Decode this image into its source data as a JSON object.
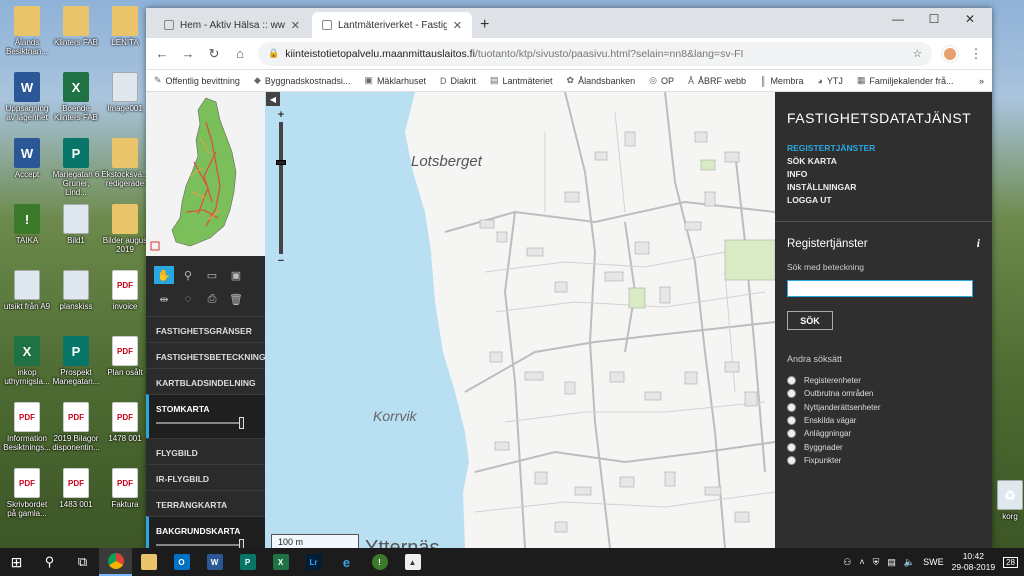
{
  "desktop": {
    "icons": [
      {
        "label": "Ålands Besiktnan...",
        "type": "folder"
      },
      {
        "label": "Klinters FAB",
        "type": "folder"
      },
      {
        "label": "LENITA",
        "type": "folder"
      },
      {
        "label": "Uppsägning av lägenhet",
        "type": "word"
      },
      {
        "label": "Boende Klinters FAB",
        "type": "excel"
      },
      {
        "label": "Image001",
        "type": "img"
      },
      {
        "label": "Accept",
        "type": "word"
      },
      {
        "label": "Mariegatan 6 Gruner, Lind...",
        "type": "pub"
      },
      {
        "label": "Ekstocksvä... redigerade",
        "type": "folder"
      },
      {
        "label": "TAIKA",
        "type": "app"
      },
      {
        "label": "Bild1",
        "type": "img"
      },
      {
        "label": "Bilder augus 2019",
        "type": "folder"
      },
      {
        "label": "utsikt från A9",
        "type": "img"
      },
      {
        "label": "planskiss",
        "type": "img"
      },
      {
        "label": "invoice",
        "type": "pdf"
      },
      {
        "label": "inkop uthyrnigsla...",
        "type": "excel"
      },
      {
        "label": "Prospekt Manegatan...",
        "type": "pub"
      },
      {
        "label": "Plan osålt",
        "type": "pdf"
      },
      {
        "label": "Information Besiktnings...",
        "type": "pdf"
      },
      {
        "label": "2019 Bilagor disponentin...",
        "type": "pdf"
      },
      {
        "label": "1478 001",
        "type": "pdf"
      },
      {
        "label": "Skrivbordet på gamla...",
        "type": "pdf"
      },
      {
        "label": "1483 001",
        "type": "pdf"
      },
      {
        "label": "Faktura",
        "type": "pdf"
      }
    ],
    "glyph_pdf": "PDF",
    "glyph_word": "W",
    "glyph_excel": "X",
    "glyph_pub": "P",
    "glyph_app": "!",
    "right_edge_label": "korg"
  },
  "browser": {
    "tabs": [
      {
        "label": "Hem - Aktiv Hälsa :: www.aland.",
        "active": false
      },
      {
        "label": "Lantmäteriverket - Fastighetsdat",
        "active": true
      }
    ],
    "new_tab": "+",
    "url_host": "kiinteistotietopalvelu.maanmittauslaitos.fi",
    "url_path": "/tuotanto/ktp/sivusto/paasivu.html?selain=nn8&lang=sv-FI",
    "bookmarks": [
      {
        "label": "Offentlig bevittning",
        "icon": "✎"
      },
      {
        "label": "Byggnadskostnadsi...",
        "icon": "◆"
      },
      {
        "label": "Mäklarhuset",
        "icon": "▣"
      },
      {
        "label": "Diakrit",
        "icon": "D"
      },
      {
        "label": "Lantmäteriet",
        "icon": "▤"
      },
      {
        "label": "Ålandsbanken",
        "icon": "✿"
      },
      {
        "label": "OP",
        "icon": "◎"
      },
      {
        "label": "ÅBRF webb",
        "icon": "Å"
      },
      {
        "label": "Membra",
        "icon": "║"
      },
      {
        "label": "YTJ",
        "icon": "◕"
      },
      {
        "label": "Familjekalender frå...",
        "icon": "▦"
      }
    ],
    "more_bookmarks": "»"
  },
  "leftpanel": {
    "layers": [
      {
        "label": "FASTIGHETSGRÄNSER",
        "on": false
      },
      {
        "label": "FASTIGHETSBETECKNINGAR",
        "on": false
      },
      {
        "label": "KARTBLADSINDELNING",
        "on": false
      },
      {
        "label": "STOMKARTA",
        "on": true,
        "opacity": 1.0
      },
      {
        "label": "FLYGBILD",
        "on": false
      },
      {
        "label": "IR-FLYGBILD",
        "on": false
      },
      {
        "label": "TERRÄNGKARTA",
        "on": false
      },
      {
        "label": "BAKGRUNDSKARTA",
        "on": true,
        "opacity": 1.0
      }
    ]
  },
  "map": {
    "place_names": [
      "Lotsberget",
      "Korrvik",
      "Ytternäs"
    ],
    "scale": "100 m",
    "zoom_plus": "+",
    "zoom_minus": "−",
    "collapse": "◀"
  },
  "rightpanel": {
    "title": "FASTIGHETSDATATJÄNST",
    "menu": [
      {
        "label": "REGISTERTJÄNSTER",
        "active": true
      },
      {
        "label": "SÖK KARTA",
        "active": false
      },
      {
        "label": "INFO",
        "active": false
      },
      {
        "label": "INSTÄLLNINGAR",
        "active": false
      },
      {
        "label": "LOGGA UT",
        "active": false
      }
    ],
    "subtitle": "Registertjänster",
    "info_icon": "i",
    "search_label": "Sök med beteckning",
    "search_value": "",
    "search_button": "SÖK",
    "other_label": "Andra söksätt",
    "options": [
      "Registerenheter",
      "Outbrutna områden",
      "Nyttjanderättsenheter",
      "Enskilda vägar",
      "Anläggningar",
      "Byggnader",
      "Fixpunkter"
    ]
  },
  "taskbar": {
    "lang": "SWE",
    "time": "10:42",
    "date": "29-08-2019",
    "notifications": "28",
    "colors": {
      "word": "#2b5797",
      "excel": "#1f7244",
      "pub": "#077568",
      "lr": "#31a8ff",
      "outlook": "#0072c6"
    }
  }
}
